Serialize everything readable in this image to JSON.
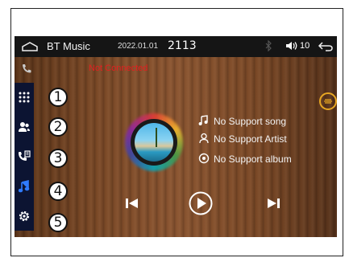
{
  "topbar": {
    "title": "BT Music",
    "date": "2022.01.01",
    "time": "2113",
    "volume": "10"
  },
  "status": {
    "connection": "Not Connected"
  },
  "track": {
    "song": "No Support song",
    "artist": "No Support Artist",
    "album": "No Support album"
  },
  "callouts": [
    "1",
    "2",
    "3",
    "4",
    "5"
  ],
  "colors": {
    "connection_text": "#e21f1f",
    "active_item": "#2f7bff",
    "hotspot_ring": "#e6a623",
    "sidebar_bg": "#0c1432"
  },
  "sidebar": {
    "items": [
      {
        "icon": "apps-grid-icon"
      },
      {
        "icon": "contacts-icon"
      },
      {
        "icon": "call-log-icon"
      },
      {
        "icon": "music-note-icon",
        "active": true
      },
      {
        "icon": "settings-icon"
      }
    ]
  }
}
